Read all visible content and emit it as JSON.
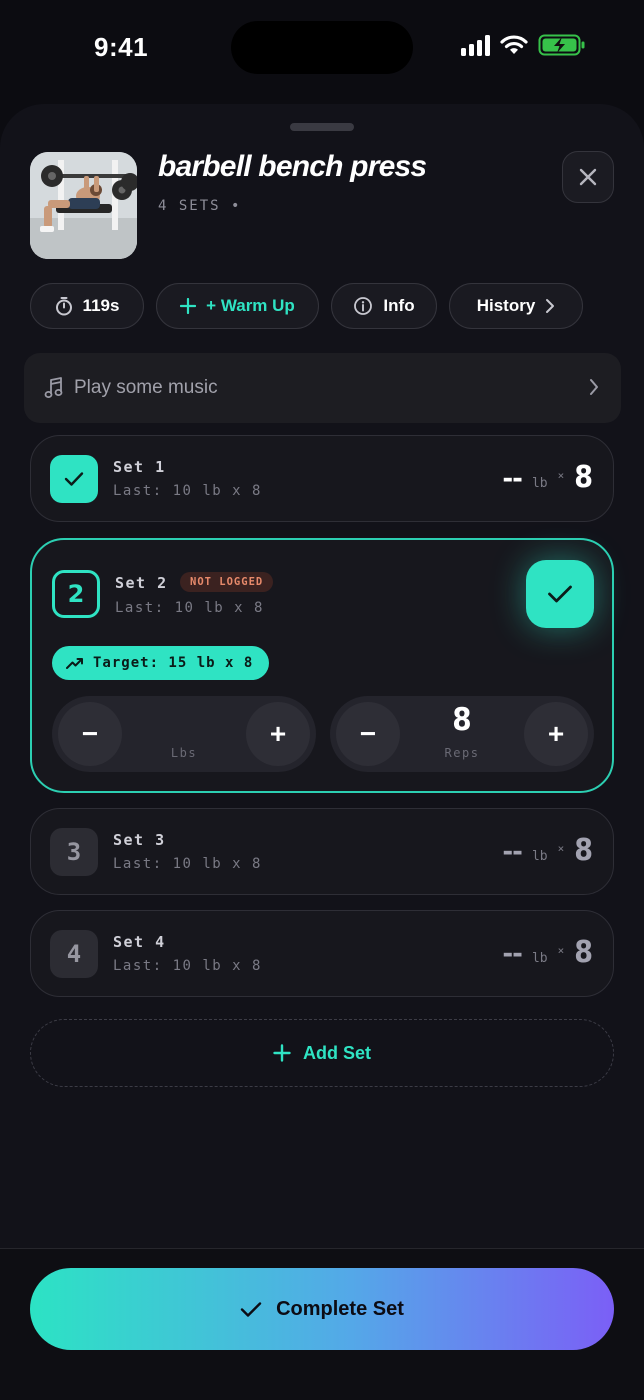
{
  "status_bar": {
    "time": "9:41"
  },
  "exercise": {
    "title": "barbell bench press",
    "subtitle": "4 SETS •"
  },
  "chips": {
    "timer": "119s",
    "warm_up": "+ Warm Up",
    "info": "Info",
    "history": "History"
  },
  "music": {
    "label": "Play some music"
  },
  "sets": [
    {
      "number": "1",
      "name": "Set 1",
      "last": "Last: 10 lb x 8",
      "weight": "--",
      "unit": "lb",
      "times": "×",
      "reps": "8",
      "status": "done"
    },
    {
      "number": "2",
      "name": "Set 2",
      "status_badge": "NOT LOGGED",
      "last": "Last: 10 lb x 8",
      "target": "Target: 15 lb x 8",
      "weight_label": "Lbs",
      "reps_value": "8",
      "reps_label": "Reps",
      "status": "active"
    },
    {
      "number": "3",
      "name": "Set 3",
      "last": "Last: 10 lb x 8",
      "weight": "--",
      "unit": "lb",
      "times": "×",
      "reps": "8",
      "status": "pending"
    },
    {
      "number": "4",
      "name": "Set 4",
      "last": "Last: 10 lb x 8",
      "weight": "--",
      "unit": "lb",
      "times": "×",
      "reps": "8",
      "status": "pending"
    }
  ],
  "stepper": {
    "minus": "−",
    "plus": "+"
  },
  "add_set": {
    "label": "Add Set"
  },
  "complete": {
    "label": "Complete Set"
  },
  "colors": {
    "accent": "#2fe3c3",
    "background": "#121219",
    "gradient_end": "#7b5ff6",
    "warning": "#e78a6b"
  },
  "icons": [
    "stopwatch-icon",
    "plus-icon",
    "info-icon",
    "chevron-right-icon",
    "music-note-icon",
    "check-icon",
    "trend-up-icon",
    "close-icon"
  ]
}
